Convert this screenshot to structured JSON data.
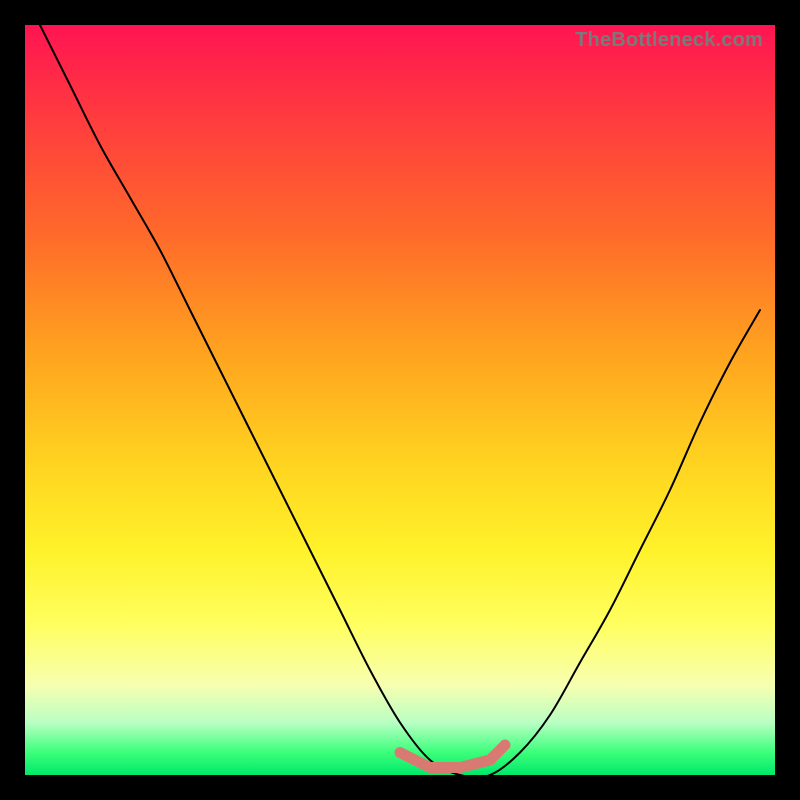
{
  "watermark": "TheBottleneck.com",
  "chart_data": {
    "type": "line",
    "title": "",
    "xlabel": "",
    "ylabel": "",
    "xlim": [
      0,
      100
    ],
    "ylim": [
      0,
      100
    ],
    "grid": false,
    "series": [
      {
        "name": "curve",
        "color": "#000000",
        "x": [
          2,
          6,
          10,
          14,
          18,
          22,
          26,
          30,
          34,
          38,
          42,
          46,
          50,
          54,
          58,
          62,
          66,
          70,
          74,
          78,
          82,
          86,
          90,
          94,
          98
        ],
        "values": [
          100,
          92,
          84,
          77,
          70,
          62,
          54,
          46,
          38,
          30,
          22,
          14,
          7,
          2,
          0,
          0,
          3,
          8,
          15,
          22,
          30,
          38,
          47,
          55,
          62
        ]
      },
      {
        "name": "highlight-band",
        "color": "#d97a72",
        "x": [
          50,
          54,
          58,
          62,
          64
        ],
        "values": [
          3,
          1,
          1,
          2,
          4
        ]
      }
    ]
  }
}
